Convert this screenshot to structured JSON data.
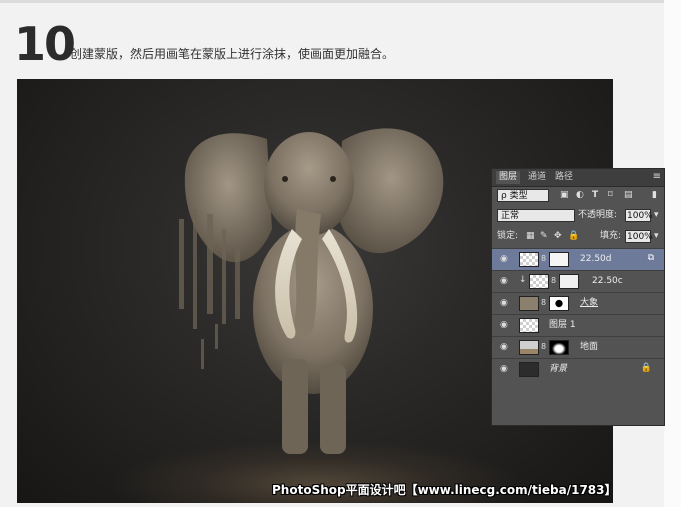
{
  "step": {
    "number": "10",
    "instruction": "创建蒙版，然后用画笔在蒙版上进行涂抹，使画面更加融合。"
  },
  "watermark": "PhotoShop平面设计吧【www.linecg.com/tieba/1783】",
  "panel": {
    "tabs": [
      {
        "label": "图层",
        "active": true
      },
      {
        "label": "通道",
        "active": false
      },
      {
        "label": "路径",
        "active": false
      }
    ],
    "menu_icon": "panel-menu-icon",
    "filter": {
      "label": "ρ 类型",
      "icons": [
        "image-filter-icon",
        "adjustment-filter-icon",
        "type-filter-icon",
        "shape-filter-icon",
        "smart-object-filter-icon"
      ]
    },
    "blend_mode": "正常",
    "opacity_label": "不透明度:",
    "opacity_value": "100%",
    "lock_label": "锁定:",
    "fill_label": "填充:",
    "fill_value": "100%",
    "layers": [
      {
        "name": "22.50d",
        "selected": true,
        "has_mask": true,
        "italic": false
      },
      {
        "name": "22.50c",
        "selected": false,
        "has_mask": true,
        "italic": false,
        "clipped": true
      },
      {
        "name": "大象",
        "selected": false,
        "has_mask": true,
        "italic": false
      },
      {
        "name": "图层 1",
        "selected": false,
        "has_mask": false,
        "italic": false
      },
      {
        "name": "地面",
        "selected": false,
        "has_mask": true,
        "italic": false
      },
      {
        "name": "背景",
        "selected": false,
        "has_mask": false,
        "italic": true,
        "locked": true
      }
    ]
  },
  "colors": {
    "panel_bg": "#535353",
    "selected_layer": "#6d7a99",
    "photo_bg": "#2a2928"
  }
}
